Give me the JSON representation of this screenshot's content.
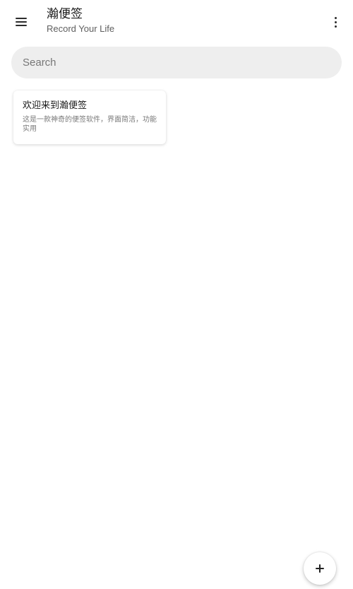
{
  "app_bar": {
    "title": "瀚便签",
    "subtitle": "Record Your Life",
    "menu_icon": "menu-icon",
    "more_icon": "more-vert-icon"
  },
  "search": {
    "placeholder": "Search",
    "value": ""
  },
  "notes": [
    {
      "title": "欢迎来到瀚便签",
      "body": "这是一款神奇的便签软件，界面简洁，功能实用"
    }
  ],
  "fab": {
    "icon": "plus-icon"
  },
  "colors": {
    "background": "#ffffff",
    "search_bg": "#eeeeee",
    "text_primary": "#1a1a1a",
    "text_secondary": "#7a7a7a"
  }
}
